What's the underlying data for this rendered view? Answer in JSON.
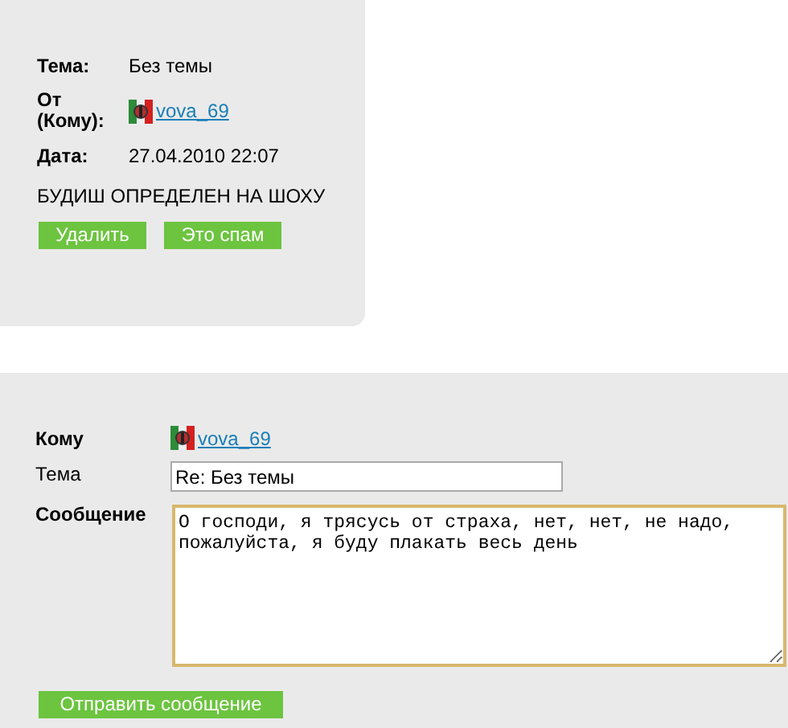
{
  "message": {
    "fields": [
      {
        "label": "Тема:",
        "kind": "text",
        "value": "Без темы"
      },
      {
        "label": "От (Кому):",
        "kind": "user",
        "value": "vova_69"
      },
      {
        "label": "Дата:",
        "kind": "text",
        "value": "27.04.2010 22:07"
      }
    ],
    "body": "БУДИШ ОПРЕДЕЛЕН НА ШОХУ",
    "buttons": [
      "Удалить",
      "Это спам"
    ]
  },
  "reply": {
    "to_label": "Кому",
    "to_user": "vova_69",
    "subject_label": "Тема",
    "subject_value": "Re: Без темы",
    "message_label": "Сообщение",
    "message_value": "О господи, я трясусь от страха, нет, нет, не надо, пожалуйста, я буду плакать весь день",
    "send_button": "Отправить сообщение"
  }
}
